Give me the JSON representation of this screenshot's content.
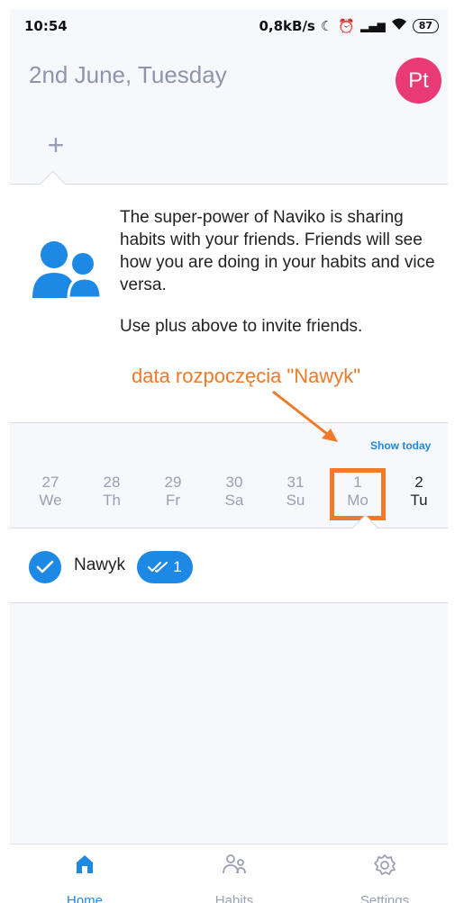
{
  "status_bar": {
    "time": "10:54",
    "speed": "0,8kB/s",
    "battery": "87"
  },
  "header": {
    "date": "2nd June, Tuesday",
    "avatar_initials": "Pt"
  },
  "invite": {
    "plus_label": "+",
    "text1": "The super-power of Naviko is sharing habits with your friends. Friends will see how you are doing in your habits and vice versa.",
    "text2": "Use plus above to invite friends."
  },
  "annotation": {
    "text": "data rozpoczęcia \"Nawyk\"",
    "color": "#f07a27"
  },
  "calendar": {
    "show_today": "Show today",
    "days": [
      {
        "num": "27",
        "name": "We"
      },
      {
        "num": "28",
        "name": "Th"
      },
      {
        "num": "29",
        "name": "Fr"
      },
      {
        "num": "30",
        "name": "Sa"
      },
      {
        "num": "31",
        "name": "Su"
      },
      {
        "num": "1",
        "name": "Mo"
      },
      {
        "num": "2",
        "name": "Tu"
      }
    ]
  },
  "habit": {
    "name": "Nawyk",
    "streak": "1"
  },
  "nav": {
    "home": "Home",
    "habits": "Habits",
    "settings": "Settings"
  },
  "colors": {
    "accent": "#1e88e5",
    "avatar": "#ea3a75",
    "muted": "#9aa0b4"
  }
}
